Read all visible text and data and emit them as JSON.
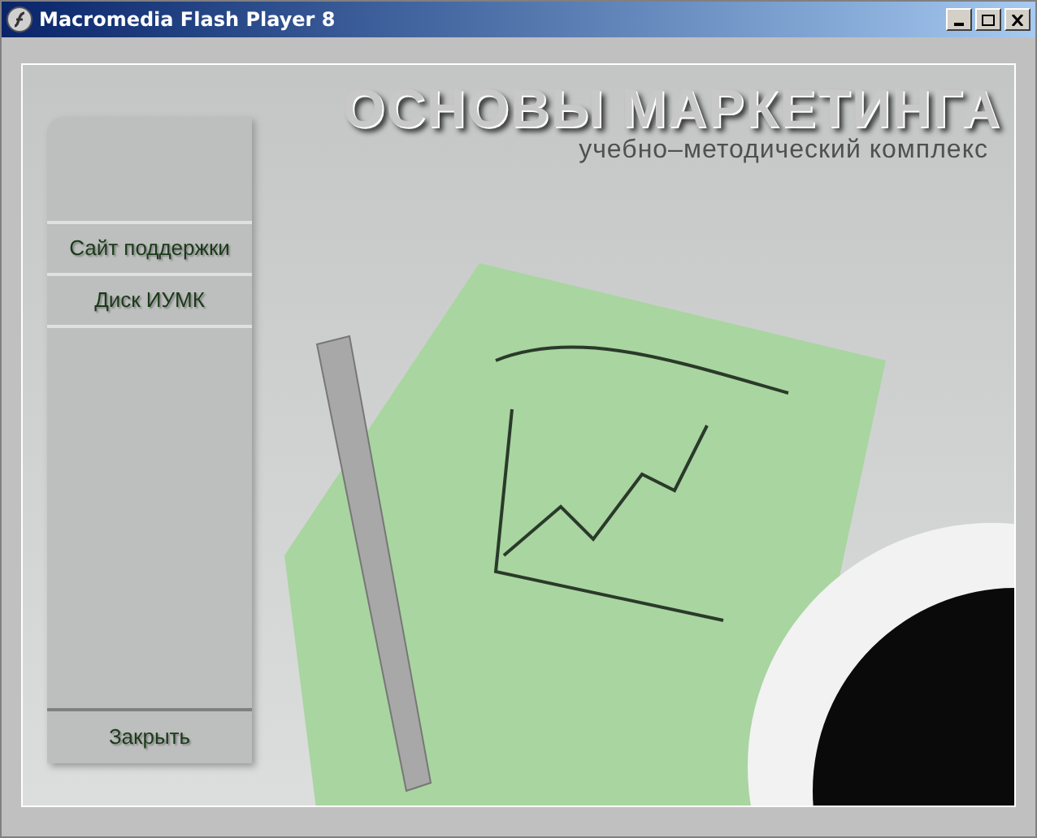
{
  "window": {
    "title": "Macromedia Flash Player 8"
  },
  "header": {
    "title": "ОСНОВЫ МАРКЕТИНГА",
    "subtitle": "учебно–методический комплекс"
  },
  "menu": [
    {
      "label": "Сайт поддержки"
    },
    {
      "label": "Диск ИУМК"
    }
  ],
  "close_button": {
    "label": "Закрыть"
  }
}
